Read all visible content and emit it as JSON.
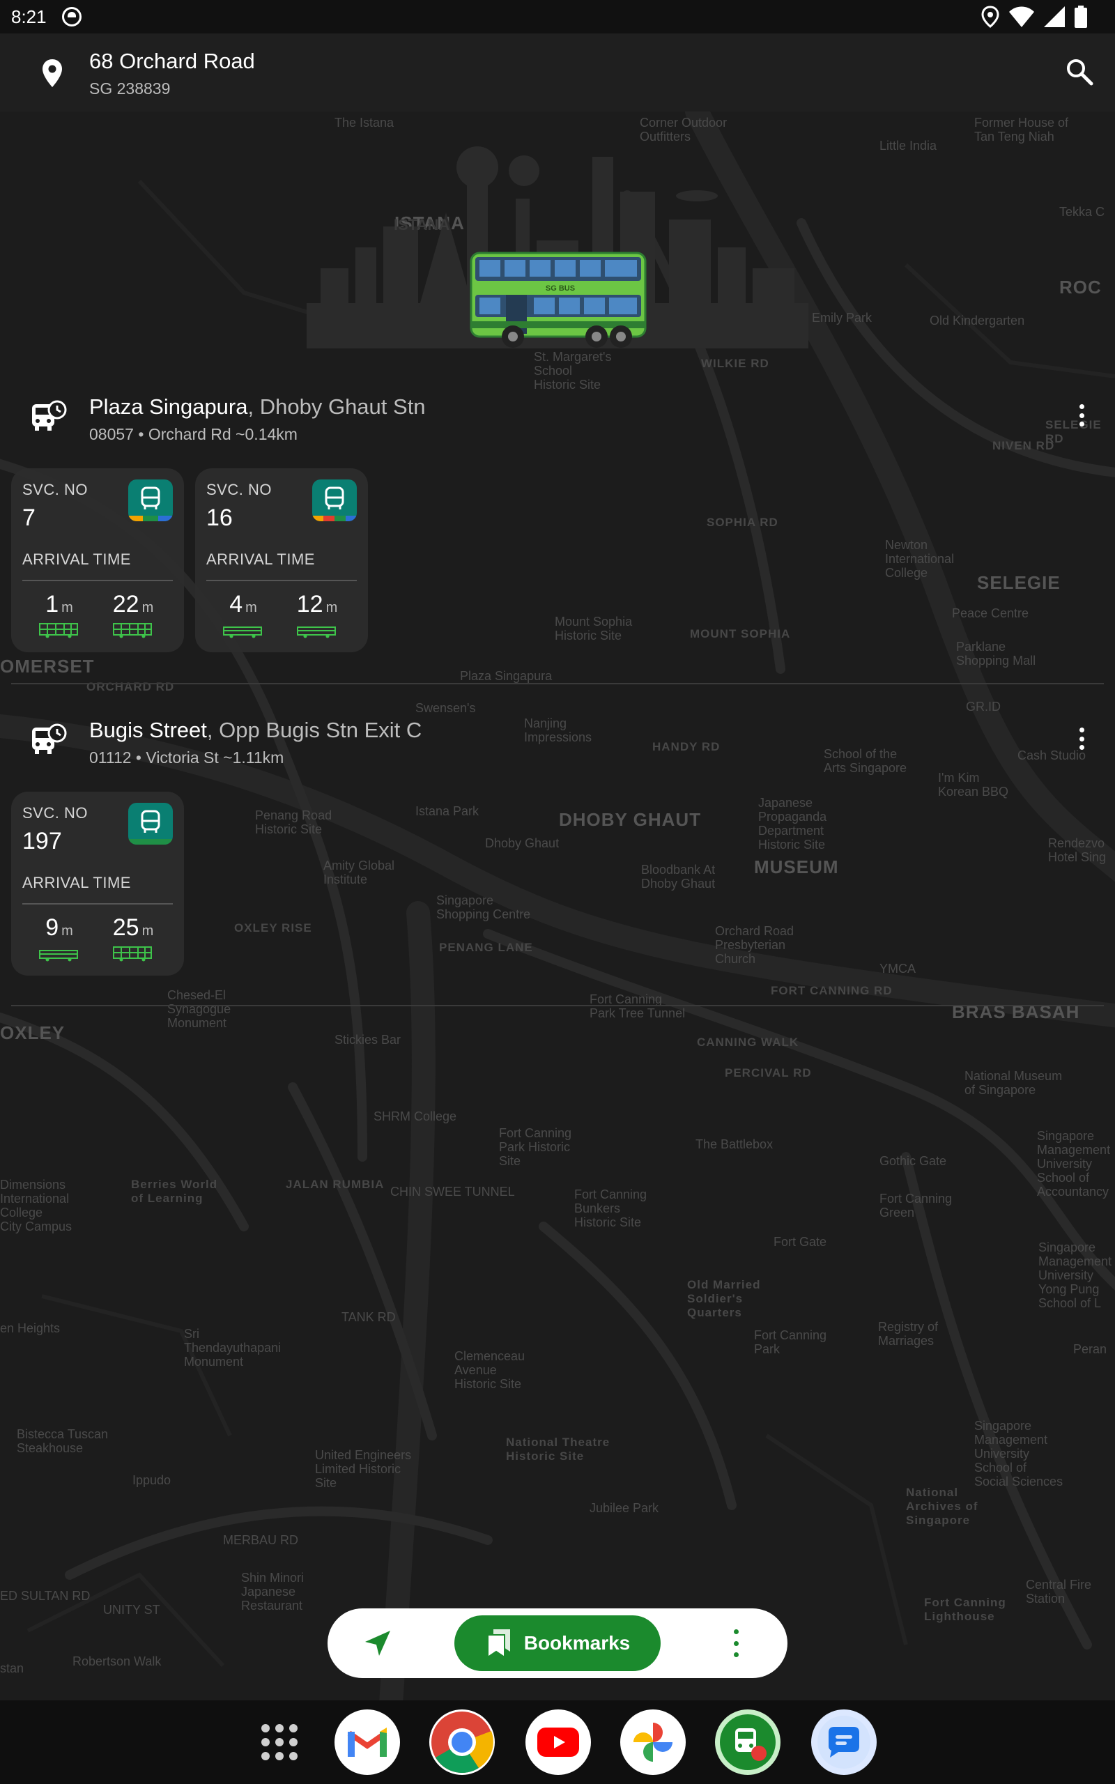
{
  "status_bar": {
    "time": "8:21"
  },
  "location": {
    "address": "68 Orchard Road",
    "postal": "SG 238839"
  },
  "illustration": {
    "bus_brand": "SG BUS"
  },
  "stops": [
    {
      "name": "Plaza Singapura",
      "name_sep": ", ",
      "area": "Dhoby Ghaut Stn",
      "code": "08057",
      "dot": " • ",
      "road": "Orchard Rd",
      "distance": " ~0.14km",
      "services": [
        {
          "svc_label": "SVC. NO",
          "svc_no": "7",
          "arrival_label": "ARRIVAL TIME",
          "arrivals": [
            {
              "value": "1",
              "unit": "m"
            },
            {
              "value": "22",
              "unit": "m"
            }
          ],
          "stripe": [
            "#f4a300",
            "#1f8f46",
            "#2c6fd6"
          ]
        },
        {
          "svc_label": "SVC. NO",
          "svc_no": "16",
          "arrival_label": "ARRIVAL TIME",
          "arrivals": [
            {
              "value": "4",
              "unit": "m"
            },
            {
              "value": "12",
              "unit": "m"
            }
          ],
          "stripe": [
            "#f4a300",
            "#e23d2e",
            "#1f8f46",
            "#2c6fd6"
          ]
        }
      ]
    },
    {
      "name": "Bugis Street",
      "name_sep": ", ",
      "area": "Opp Bugis Stn Exit C",
      "code": "01112",
      "dot": " • ",
      "road": "Victoria St",
      "distance": " ~1.11km",
      "services": [
        {
          "svc_label": "SVC. NO",
          "svc_no": "197",
          "arrival_label": "ARRIVAL TIME",
          "arrivals": [
            {
              "value": "9",
              "unit": "m"
            },
            {
              "value": "25",
              "unit": "m"
            }
          ],
          "stripe": [
            "#1f8f46"
          ]
        }
      ]
    }
  ],
  "bottom_bar": {
    "bookmarks_label": "Bookmarks"
  },
  "map_labels": [
    "The Istana",
    "Corner Outdoor\nOutfitters",
    "Former House of\nTan Teng Niah",
    "Little India",
    "Tekka C",
    "ISTANA",
    "ROC",
    "Mount Emily Park",
    "Old Kindergarten",
    "St. Margaret's\nSchool\nHistoric Site",
    "WILKIE RD",
    "SELEGIE RD",
    "NIVEN RD",
    "SOPHIA RD",
    "Newton\nInternational\nCollege",
    "SELEGIE",
    "Peace Centre",
    "Parklane\nShopping Mall",
    "Mount Sophia\nHistoric Site",
    "MOUNT SOPHIA",
    "OMERSET",
    "ORCHARD RD",
    "Plaza Singapura",
    "GR.ID",
    "Swensen's",
    "Nanjing\nImpressions",
    "HANDY RD",
    "School of the\nArts Singapore",
    "I'm Kim\nKorean BBQ",
    "Cash Studio",
    "Istana Park",
    "DHOBY GHAUT",
    "Dhoby Ghaut",
    "Japanese\nPropaganda\nDepartment\nHistoric Site",
    "Penang Road\nHistoric Site",
    "Amity Global\nInstitute",
    "Bloodbank At\nDhoby Ghaut",
    "MUSEUM",
    "Rendezvo\nHotel Sing",
    "Singapore\nShopping Centre",
    "OXLEY RISE",
    "Orchard Road\nPresbyterian\nChurch",
    "YMCA",
    "PENANG LANE",
    "FORT CANNING RD",
    "Chesed-El\nSynagogue\nMonument",
    "Fort Canning\nPark Tree Tunnel",
    "BRAS BASAH",
    "OXLEY",
    "Stickies Bar",
    "CANNING WALK",
    "PERCIVAL RD",
    "National Museum\nof Singapore",
    "SHRM College",
    "Fort Canning\nPark Historic\nSite",
    "The Battlebox",
    "Gothic Gate",
    "Singapore\nManagement\nUniversity\nSchool of\nAccountancy",
    "Dimensions\nInternational\nCollege\nCity Campus",
    "Berries World\nof Learning",
    "JALAN RUMBIA",
    "CHIN SWEE TUNNEL",
    "Fort Canning\nBunkers\nHistoric Site",
    "Fort Canning\nGreen",
    "Fort Gate",
    "Singapore\nManagement\nUniversity\nYong Pung\nSchool of L",
    "Old Married\nSoldier's\nQuarters",
    "en Heights",
    "Sri\nThendayuthapani\nMonument",
    "TANK RD",
    "Clemenceau\nAvenue\nHistoric Site",
    "Fort Canning\nPark",
    "Registry of\nMarriages",
    "Peran",
    "Bistecca Tuscan\nSteakhouse",
    "Ippudo",
    "United Engineers\nLimited Historic\nSite",
    "National Theatre\nHistoric Site",
    "Singapore\nManagement\nUniversity\nSchool of\nSocial Sciences",
    "Jubilee Park",
    "National\nArchives of\nSingapore",
    "MERBAU RD",
    "Shin Minori\nJapanese\nRestaurant",
    "Central Fire\nStation",
    "Fort Canning\nLighthouse",
    "UNITY ST",
    "ED SULTAN RD",
    "Robertson Walk",
    "stan"
  ]
}
